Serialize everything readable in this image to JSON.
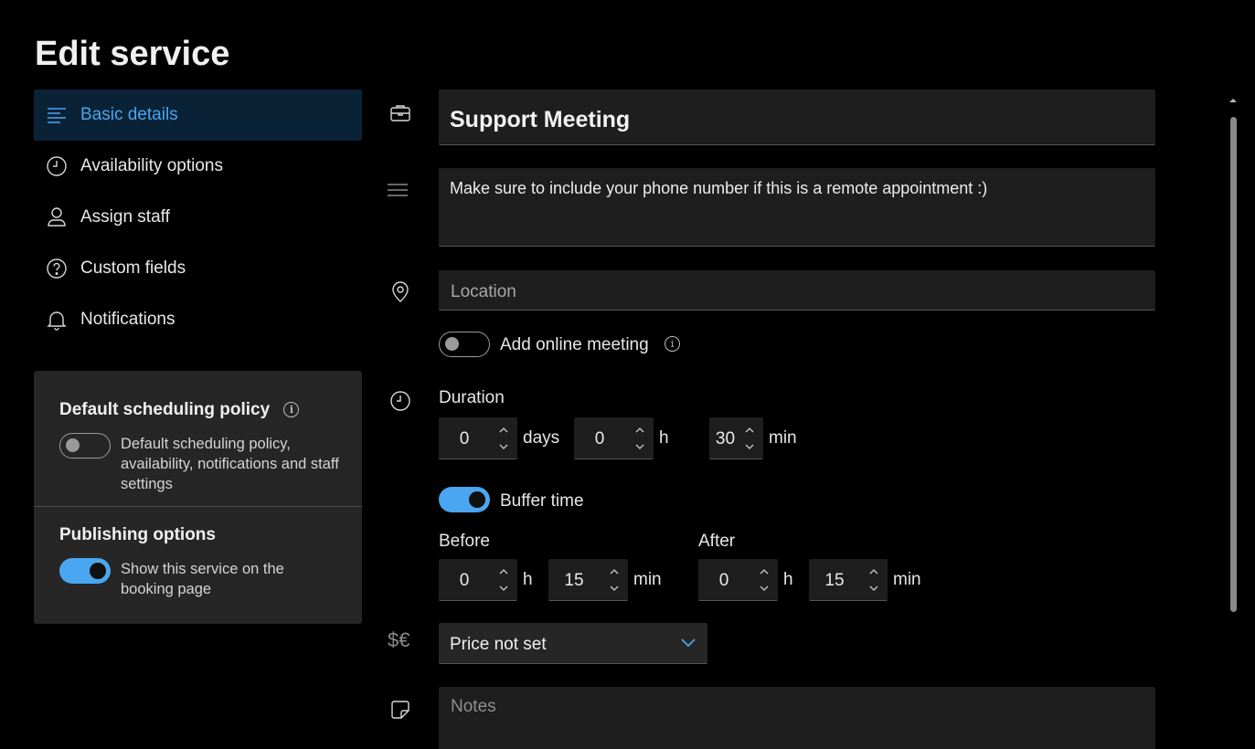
{
  "page": {
    "title": "Edit service"
  },
  "sidebar": {
    "items": [
      {
        "label": "Basic details",
        "icon": "menu-lines-icon",
        "active": true
      },
      {
        "label": "Availability options",
        "icon": "clock-icon"
      },
      {
        "label": "Assign staff",
        "icon": "person-icon"
      },
      {
        "label": "Custom fields",
        "icon": "question-icon"
      },
      {
        "label": "Notifications",
        "icon": "bell-icon"
      }
    ]
  },
  "policy_card": {
    "default_heading": "Default scheduling policy",
    "default_info": "i",
    "default_toggle_on": false,
    "default_text": "Default scheduling policy, availability, notifications and staff settings",
    "publishing_heading": "Publishing options",
    "publishing_toggle_on": true,
    "publishing_text": "Show this service on the booking page"
  },
  "form": {
    "service_name": "Support Meeting",
    "description": "Make sure to include your phone number if this is a remote appointment :)",
    "location_placeholder": "Location",
    "online_meeting_label": "Add online meeting",
    "online_meeting_on": false,
    "online_meeting_info": "i",
    "duration": {
      "label": "Duration",
      "days": "0",
      "days_unit": "days",
      "hours": "0",
      "hours_unit": "h",
      "minutes": "30",
      "minutes_unit": "min"
    },
    "buffer": {
      "label": "Buffer time",
      "on": true,
      "before_label": "Before",
      "before_hours": "0",
      "before_hours_unit": "h",
      "before_minutes": "15",
      "before_minutes_unit": "min",
      "after_label": "After",
      "after_hours": "0",
      "after_hours_unit": "h",
      "after_minutes": "15",
      "after_minutes_unit": "min"
    },
    "price_glyph": "$€",
    "price_value": "Price not set",
    "notes_placeholder": "Notes"
  },
  "colors": {
    "accent": "#4aa6f0",
    "background": "#000000",
    "field": "#1e1e1e",
    "card": "#262626"
  }
}
